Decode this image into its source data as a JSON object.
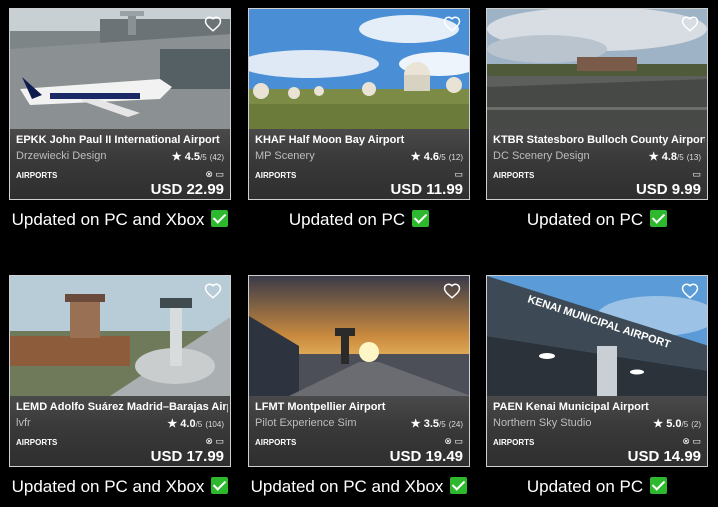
{
  "cards": [
    {
      "title": "EPKK John Paul II International Airport",
      "developer": "Drzewiecki Design",
      "rating": "4.5",
      "rating_max": "/5",
      "rating_count": "(42)",
      "category": "AIRPORTS",
      "price": "USD 22.99",
      "update_note": "Updated on PC and Xbox",
      "thumbnail": "airliner-at-terminal"
    },
    {
      "title": "KHAF Half Moon Bay Airport",
      "developer": "MP Scenery",
      "rating": "4.6",
      "rating_max": "/5",
      "rating_count": "(12)",
      "category": "AIRPORTS",
      "price": "USD 11.99",
      "update_note": "Updated on PC",
      "thumbnail": "radar-domes"
    },
    {
      "title": "KTBR Statesboro Bulloch County Airport",
      "developer": "DC Scenery Design",
      "rating": "4.8",
      "rating_max": "/5",
      "rating_count": "(13)",
      "category": "AIRPORTS",
      "price": "USD 9.99",
      "update_note": "Updated on PC",
      "thumbnail": "runway-hangar"
    },
    {
      "title": "LEMD Adolfo Suárez Madrid–Barajas Airport",
      "developer": "lvfr",
      "rating": "4.0",
      "rating_max": "/5",
      "rating_count": "(104)",
      "category": "AIRPORTS",
      "price": "USD 17.99",
      "update_note": "Updated on PC and Xbox",
      "thumbnail": "control-towers"
    },
    {
      "title": "LFMT Montpellier Airport",
      "developer": "Pilot Experience Sim",
      "rating": "3.5",
      "rating_max": "/5",
      "rating_count": "(24)",
      "category": "AIRPORTS",
      "price": "USD 19.49",
      "update_note": "Updated on PC and Xbox",
      "thumbnail": "sunset-tower"
    },
    {
      "title": "PAEN Kenai Municipal Airport",
      "developer": "Northern Sky Studio",
      "rating": "5.0",
      "rating_max": "/5",
      "rating_count": "(2)",
      "category": "AIRPORTS",
      "price": "USD 14.99",
      "update_note": "Updated on PC",
      "thumbnail": "terminal-sign",
      "sign_text": "KENAI MUNICIPAL AIRPORT"
    }
  ],
  "icons": {
    "favorite": "heart-outline-icon",
    "star": "star-icon",
    "xbox": "xbox-icon",
    "pc": "pc-icon",
    "check": "checkmark-icon"
  },
  "colors": {
    "check": "#2eb82e",
    "card_bg": "#2c2c2c",
    "background": "#000000"
  }
}
